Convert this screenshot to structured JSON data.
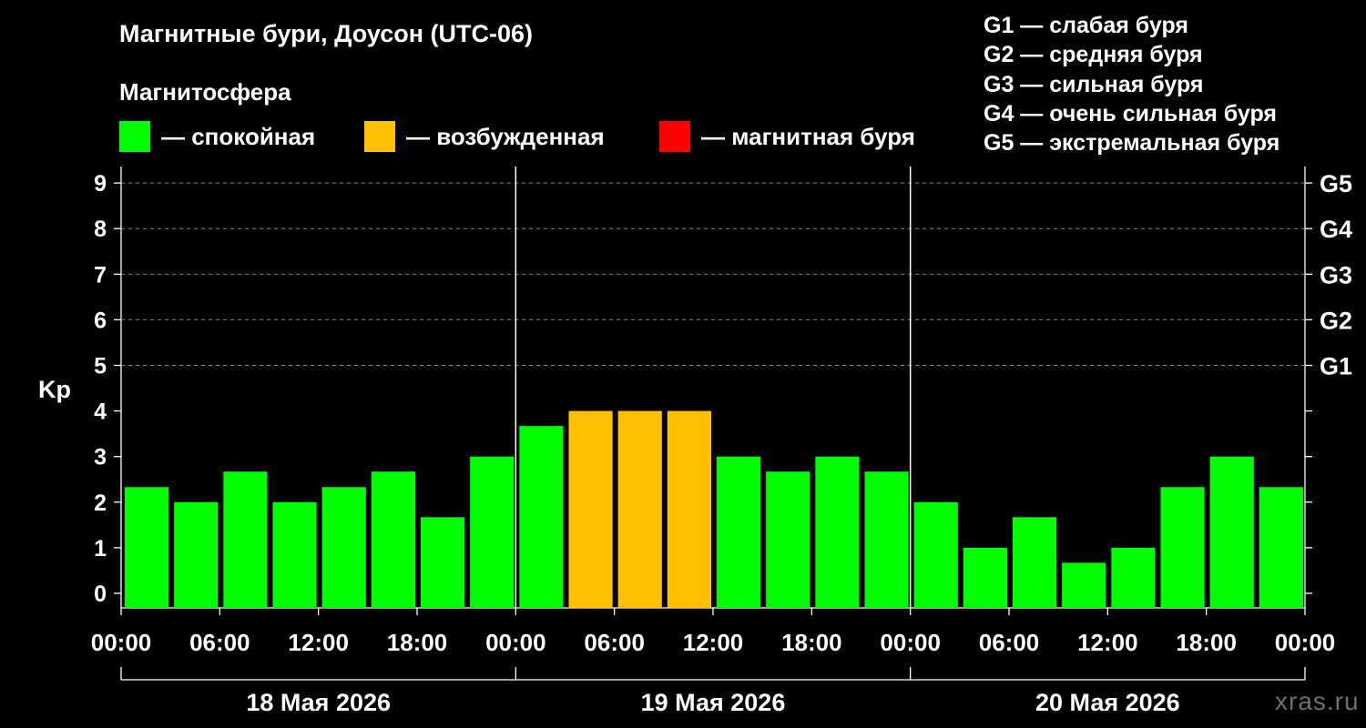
{
  "header": {
    "title": "Магнитные бури, Доусон (UTC-06)",
    "section_label": "Магнитосфера"
  },
  "legend": [
    {
      "label": "— спокойная",
      "color": "#00ff00"
    },
    {
      "label": "— возбужденная",
      "color": "#ffc000"
    },
    {
      "label": "— магнитная буря",
      "color": "#ff0000"
    }
  ],
  "storm_levels": [
    {
      "label": "G1 — слабая буря"
    },
    {
      "label": "G2 — средняя буря"
    },
    {
      "label": "G3 — сильная буря"
    },
    {
      "label": "G4 — очень сильная буря"
    },
    {
      "label": "G5 — экстремальная буря"
    }
  ],
  "watermark": "xras.ru",
  "chart_data": {
    "type": "bar",
    "ylabel": "Kp",
    "ylim": [
      0,
      9
    ],
    "y_ticks": [
      "0",
      "1",
      "2",
      "3",
      "4",
      "5",
      "6",
      "7",
      "8",
      "9"
    ],
    "right_axis_labels": [
      {
        "kp": 5,
        "label": "G1"
      },
      {
        "kp": 6,
        "label": "G2"
      },
      {
        "kp": 7,
        "label": "G3"
      },
      {
        "kp": 8,
        "label": "G4"
      },
      {
        "kp": 9,
        "label": "G5"
      }
    ],
    "grid": "dashed horizontal at Kp 5–9",
    "x_tick_labels": [
      "00:00",
      "06:00",
      "12:00",
      "18:00",
      "00:00",
      "06:00",
      "12:00",
      "18:00",
      "00:00",
      "06:00",
      "12:00",
      "18:00",
      "00:00"
    ],
    "days": [
      "18 Мая 2026",
      "19 Мая 2026",
      "20 Мая 2026"
    ],
    "interval_hours": 3,
    "values": [
      2.33,
      2.0,
      2.67,
      2.0,
      2.33,
      2.67,
      1.67,
      3.0,
      3.67,
      4.0,
      4.0,
      4.0,
      3.0,
      2.67,
      3.0,
      2.67,
      2.0,
      1.0,
      1.67,
      0.67,
      1.0,
      2.33,
      3.0,
      2.33
    ],
    "colors": {
      "quiet": "#00ff00",
      "active": "#ffc000",
      "storm": "#ff0000",
      "grid": "#888888"
    }
  }
}
